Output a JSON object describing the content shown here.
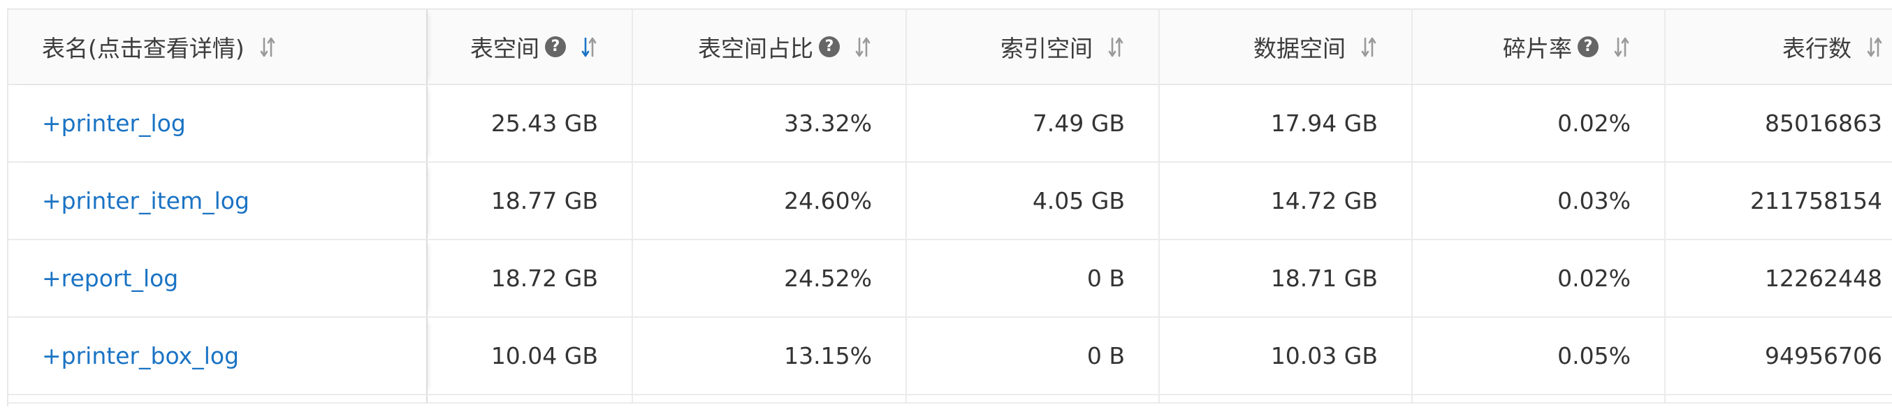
{
  "table": {
    "columns": [
      {
        "label": "表名(点击查看详情)",
        "help": false,
        "sort": "none"
      },
      {
        "label": "表空间",
        "help": true,
        "sort": "desc"
      },
      {
        "label": "表空间占比",
        "help": true,
        "sort": "none"
      },
      {
        "label": "索引空间",
        "help": false,
        "sort": "none"
      },
      {
        "label": "数据空间",
        "help": false,
        "sort": "none"
      },
      {
        "label": "碎片率",
        "help": true,
        "sort": "none"
      },
      {
        "label": "表行数",
        "help": false,
        "sort": "none"
      }
    ],
    "rows": [
      {
        "name": "+printer_log",
        "table_space": "25.43 GB",
        "space_ratio": "33.32%",
        "index_space": "7.49 GB",
        "data_space": "17.94 GB",
        "fragmentation": "0.02%",
        "row_count": "85016863"
      },
      {
        "name": "+printer_item_log",
        "table_space": "18.77 GB",
        "space_ratio": "24.60%",
        "index_space": "4.05 GB",
        "data_space": "14.72 GB",
        "fragmentation": "0.03%",
        "row_count": "211758154"
      },
      {
        "name": "+report_log",
        "table_space": "18.72 GB",
        "space_ratio": "24.52%",
        "index_space": "0 B",
        "data_space": "18.71 GB",
        "fragmentation": "0.02%",
        "row_count": "12262448"
      },
      {
        "name": "+printer_box_log",
        "table_space": "10.04 GB",
        "space_ratio": "13.15%",
        "index_space": "0 B",
        "data_space": "10.03 GB",
        "fragmentation": "0.05%",
        "row_count": "94956706"
      }
    ]
  },
  "icons": {
    "help": "question-circle-icon",
    "sort": "sort-arrows-icon"
  },
  "colors": {
    "link": "#1a73c4",
    "sort_active": "#1a73c4",
    "sort_inactive": "#9a9a9a",
    "help_bg": "#666666",
    "header_bg": "#fafafa",
    "border": "#ebebeb"
  }
}
